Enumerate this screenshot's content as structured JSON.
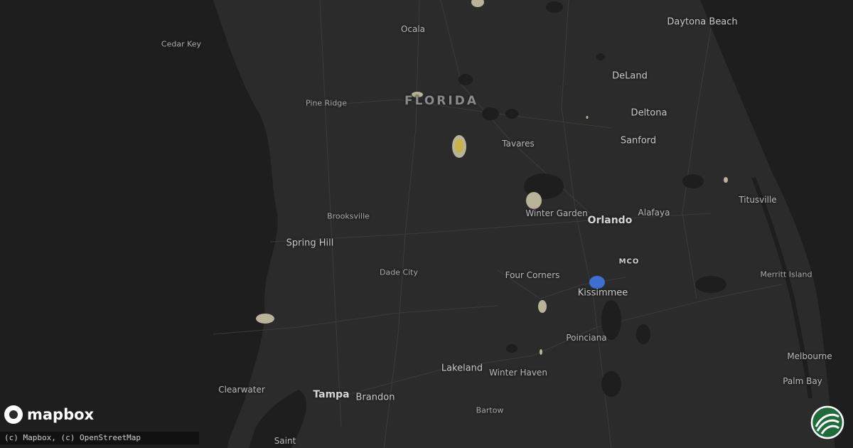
{
  "map": {
    "state_label": "FLORIDA",
    "airport_label": "MCO",
    "cities": [
      {
        "name": "Daytona Beach",
        "size": "l"
      },
      {
        "name": "Ocala",
        "size": "m"
      },
      {
        "name": "Cedar Key",
        "size": "s"
      },
      {
        "name": "DeLand",
        "size": "l"
      },
      {
        "name": "Pine Ridge",
        "size": "s"
      },
      {
        "name": "Deltona",
        "size": "l"
      },
      {
        "name": "Tavares",
        "size": "m"
      },
      {
        "name": "Sanford",
        "size": "l"
      },
      {
        "name": "Winter Garden",
        "size": "m"
      },
      {
        "name": "Alafaya",
        "size": "m"
      },
      {
        "name": "Titusville",
        "size": "m"
      },
      {
        "name": "Brooksville",
        "size": "s"
      },
      {
        "name": "Orlando",
        "size": "xl"
      },
      {
        "name": "Spring Hill",
        "size": "l"
      },
      {
        "name": "Dade City",
        "size": "s"
      },
      {
        "name": "Four Corners",
        "size": "m"
      },
      {
        "name": "Merritt Island",
        "size": "s"
      },
      {
        "name": "Kissimmee",
        "size": "l"
      },
      {
        "name": "Poinciana",
        "size": "m"
      },
      {
        "name": "Melbourne",
        "size": "m"
      },
      {
        "name": "Lakeland",
        "size": "l"
      },
      {
        "name": "Winter Haven",
        "size": "m"
      },
      {
        "name": "Palm Bay",
        "size": "m"
      },
      {
        "name": "Clearwater",
        "size": "m"
      },
      {
        "name": "Tampa",
        "size": "xl"
      },
      {
        "name": "Brandon",
        "size": "l"
      },
      {
        "name": "Bartow",
        "size": "s"
      },
      {
        "name": "Saint",
        "size": "m"
      }
    ]
  },
  "logo_text": "mapbox",
  "attribution": "(c) Mapbox, (c) OpenStreetMap",
  "colors": {
    "land": "#2b2b2b",
    "water": "#1e1e1e",
    "roads": "#3a3a3a",
    "hail_small": "#b9b39a",
    "hail_medium": "#c9b24a",
    "hail_large": "#3f6fd0"
  }
}
